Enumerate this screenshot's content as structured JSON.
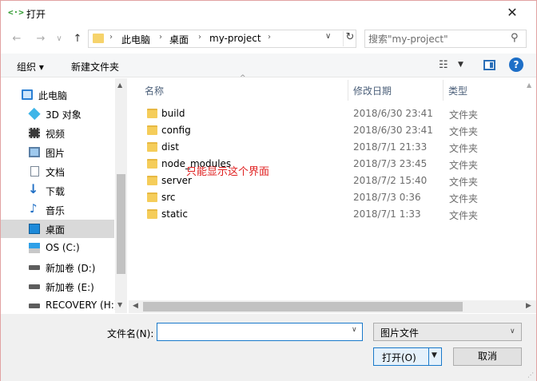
{
  "window": {
    "title": "打开",
    "app_icon": "<·>",
    "close_glyph": "✕"
  },
  "nav_buttons": {
    "back": "←",
    "forward": "→",
    "recent": "∨",
    "up": "↑"
  },
  "address": {
    "crumbs": [
      "此电脑",
      "桌面",
      "my-project"
    ],
    "separator": "›",
    "refresh_glyph": "↻",
    "dropdown_glyph": "∨"
  },
  "search": {
    "placeholder": "搜索\"my-project\"",
    "icon_glyph": "⚲"
  },
  "toolbar": {
    "organize": "组织 ▾",
    "new_folder": "新建文件夹",
    "view_glyph": "☷",
    "view_dd": "▼",
    "help_glyph": "?"
  },
  "nav_pane": {
    "items": [
      {
        "label": "此电脑",
        "icon": "computer-icon"
      },
      {
        "label": "3D 对象",
        "icon": "cube-icon"
      },
      {
        "label": "视频",
        "icon": "video-icon"
      },
      {
        "label": "图片",
        "icon": "picture-icon"
      },
      {
        "label": "文档",
        "icon": "document-icon"
      },
      {
        "label": "下载",
        "icon": "download-icon"
      },
      {
        "label": "音乐",
        "icon": "music-icon"
      },
      {
        "label": "桌面",
        "icon": "desktop-icon"
      },
      {
        "label": "OS (C:)",
        "icon": "windows-drive-icon"
      },
      {
        "label": "新加卷 (D:)",
        "icon": "drive-icon"
      },
      {
        "label": "新加卷 (E:)",
        "icon": "drive-icon"
      },
      {
        "label": "RECOVERY (H:)",
        "icon": "drive-icon"
      }
    ],
    "selected_index": 7
  },
  "file_list": {
    "columns": [
      "名称",
      "修改日期",
      "类型"
    ],
    "sort_glyph": "^",
    "rows": [
      {
        "name": "build",
        "date": "2018/6/30 23:41",
        "type": "文件夹"
      },
      {
        "name": "config",
        "date": "2018/6/30 23:41",
        "type": "文件夹"
      },
      {
        "name": "dist",
        "date": "2018/7/1 21:33",
        "type": "文件夹"
      },
      {
        "name": "node_modules",
        "date": "2018/7/3 23:45",
        "type": "文件夹"
      },
      {
        "name": "server",
        "date": "2018/7/2 15:40",
        "type": "文件夹"
      },
      {
        "name": "src",
        "date": "2018/7/3 0:36",
        "type": "文件夹"
      },
      {
        "name": "static",
        "date": "2018/7/1 1:33",
        "type": "文件夹"
      }
    ]
  },
  "annotation": "只能显示这个界面",
  "scroll": {
    "up": "▲",
    "down": "▼",
    "left": "◀",
    "right": "▶"
  },
  "bottom": {
    "filename_label": "文件名(N):",
    "filename_value": "",
    "filetype_value": "图片文件",
    "open_label": "打开(O)",
    "cancel_label": "取消",
    "dropdown_glyph": "∨",
    "split_glyph": "▼",
    "grip": "⋰"
  },
  "colors": {
    "folder": "#f5cd5a",
    "selection": "#d9d9d9",
    "accent": "#1979ca",
    "annotation": "#e02020"
  }
}
